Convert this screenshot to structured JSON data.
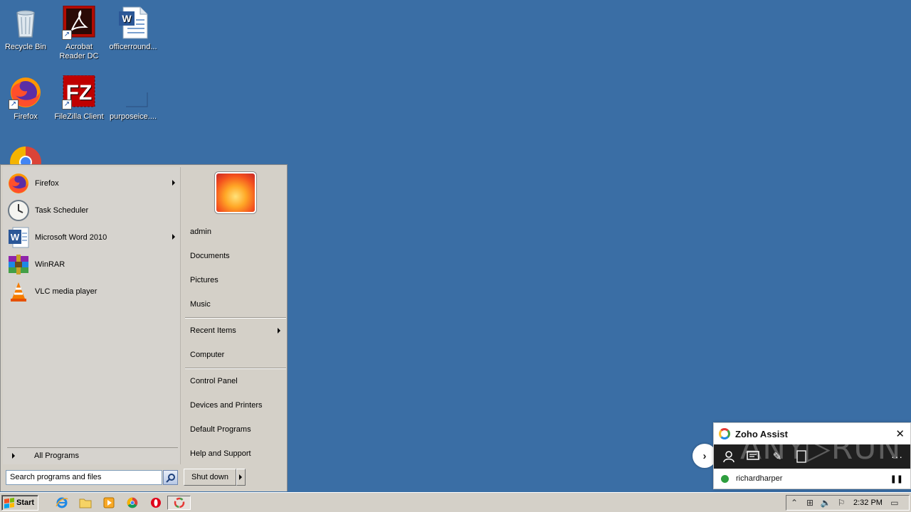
{
  "desktop": {
    "icons": [
      {
        "label": "Recycle Bin",
        "icon": "recycle-bin-icon"
      },
      {
        "label": "Acrobat Reader DC",
        "icon": "acrobat-icon"
      },
      {
        "label": "officerround...",
        "icon": "word-document-icon"
      },
      {
        "label": "Firefox",
        "icon": "firefox-icon"
      },
      {
        "label": "FileZilla Client",
        "icon": "filezilla-icon"
      },
      {
        "label": "purposeice....",
        "icon": "blank-file-icon"
      },
      {
        "label": "",
        "icon": "chrome-icon"
      }
    ]
  },
  "start_menu": {
    "pinned": [
      {
        "label": "Firefox",
        "icon": "firefox-icon",
        "submenu": true
      },
      {
        "label": "Task Scheduler",
        "icon": "clock-icon",
        "submenu": false
      },
      {
        "label": "Microsoft Word 2010",
        "icon": "word-icon",
        "submenu": true
      },
      {
        "label": "WinRAR",
        "icon": "winrar-icon",
        "submenu": false
      },
      {
        "label": "VLC media player",
        "icon": "vlc-icon",
        "submenu": false
      }
    ],
    "all_programs": "All Programs",
    "right_items": [
      {
        "label": "admin"
      },
      {
        "label": "Documents"
      },
      {
        "label": "Pictures"
      },
      {
        "label": "Music"
      },
      {
        "label": "Recent Items",
        "submenu": true
      },
      {
        "label": "Computer"
      },
      {
        "label": "Control Panel"
      },
      {
        "label": "Devices and Printers"
      },
      {
        "label": "Default Programs"
      },
      {
        "label": "Help and Support"
      }
    ],
    "search_placeholder": "Search programs and files",
    "shutdown_label": "Shut down"
  },
  "taskbar": {
    "start_label": "Start",
    "quick_launch": [
      "internet-explorer-icon",
      "folder-icon",
      "media-player-icon",
      "chrome-icon",
      "opera-icon",
      "chrome-active-icon"
    ],
    "clock": "2:32 PM"
  },
  "zoho": {
    "title": "Zoho Assist",
    "user": "richardharper",
    "status_color": "#2e9e3e",
    "more": "···"
  },
  "watermark": "ANY▷RUN",
  "colors": {
    "desktop": "#3a6ea5",
    "menu": "#d4d0c8"
  }
}
